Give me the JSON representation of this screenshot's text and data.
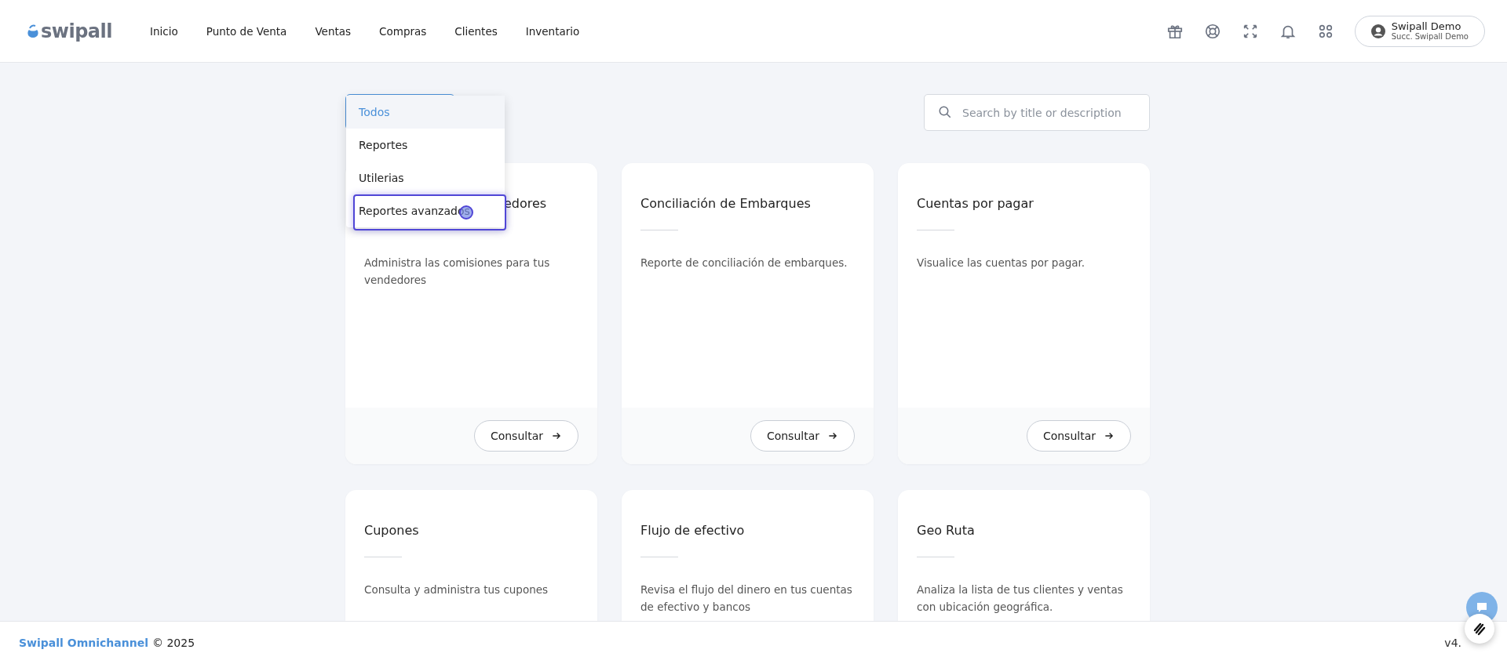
{
  "header": {
    "logo": "swipall",
    "nav": [
      {
        "label": "Inicio"
      },
      {
        "label": "Punto de Venta"
      },
      {
        "label": "Ventas"
      },
      {
        "label": "Compras"
      },
      {
        "label": "Clientes"
      },
      {
        "label": "Inventario"
      }
    ],
    "user": {
      "name": "Swipall Demo",
      "branch": "Succ. Swipall Demo"
    }
  },
  "filter": {
    "options": [
      {
        "label": "Todos",
        "selected": true,
        "highlighted": false
      },
      {
        "label": "Reportes",
        "selected": false,
        "highlighted": false
      },
      {
        "label": "Utilerias",
        "selected": false,
        "highlighted": false
      },
      {
        "label": "Reportes avanzados",
        "selected": false,
        "highlighted": true
      }
    ]
  },
  "search": {
    "placeholder": "Search by title or description"
  },
  "cards": [
    {
      "title": "edores",
      "covered": true,
      "description": "Administra las comisiones para tus vendedores",
      "button": "Consultar"
    },
    {
      "title": "Conciliación de Embarques",
      "covered": false,
      "description": "Reporte de conciliación de embarques.",
      "button": "Consultar"
    },
    {
      "title": "Cuentas por pagar",
      "covered": false,
      "description": "Visualice las cuentas por pagar.",
      "button": "Consultar"
    },
    {
      "title": "Cupones",
      "covered": false,
      "description": "Consulta y administra tus cupones"
    },
    {
      "title": "Flujo de efectivo",
      "covered": false,
      "description": "Revisa el flujo del dinero en tus cuentas de efectivo y bancos"
    },
    {
      "title": "Geo Ruta",
      "covered": false,
      "description": "Analiza la lista de tus clientes y ventas con ubicación geográfica."
    }
  ],
  "footer": {
    "brand": "Swipall Omnichannel",
    "copyright": "© 2025",
    "version": "v4."
  }
}
